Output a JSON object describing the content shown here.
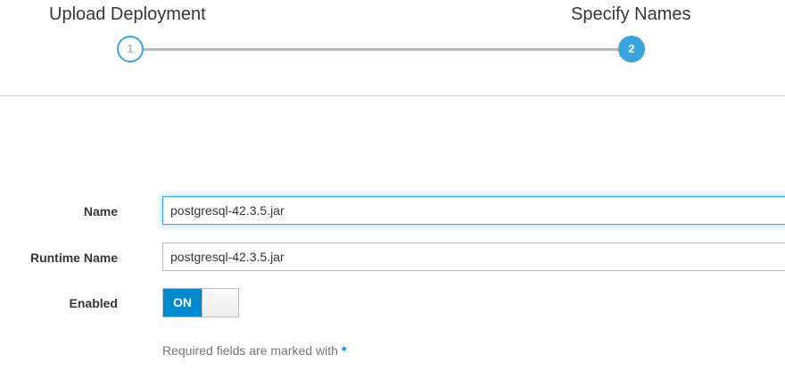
{
  "wizard": {
    "steps": [
      {
        "number": "1",
        "title": "Upload Deployment"
      },
      {
        "number": "2",
        "title": "Specify Names"
      }
    ],
    "accent_color": "#39a5dc"
  },
  "form": {
    "name": {
      "label": "Name",
      "value": "postgresql-42.3.5.jar"
    },
    "runtime_name": {
      "label": "Runtime Name",
      "value": "postgresql-42.3.5.jar"
    },
    "enabled": {
      "label": "Enabled",
      "toggle_label": "ON",
      "state": true
    },
    "required_note": "Required fields are marked with",
    "required_marker": "*"
  }
}
